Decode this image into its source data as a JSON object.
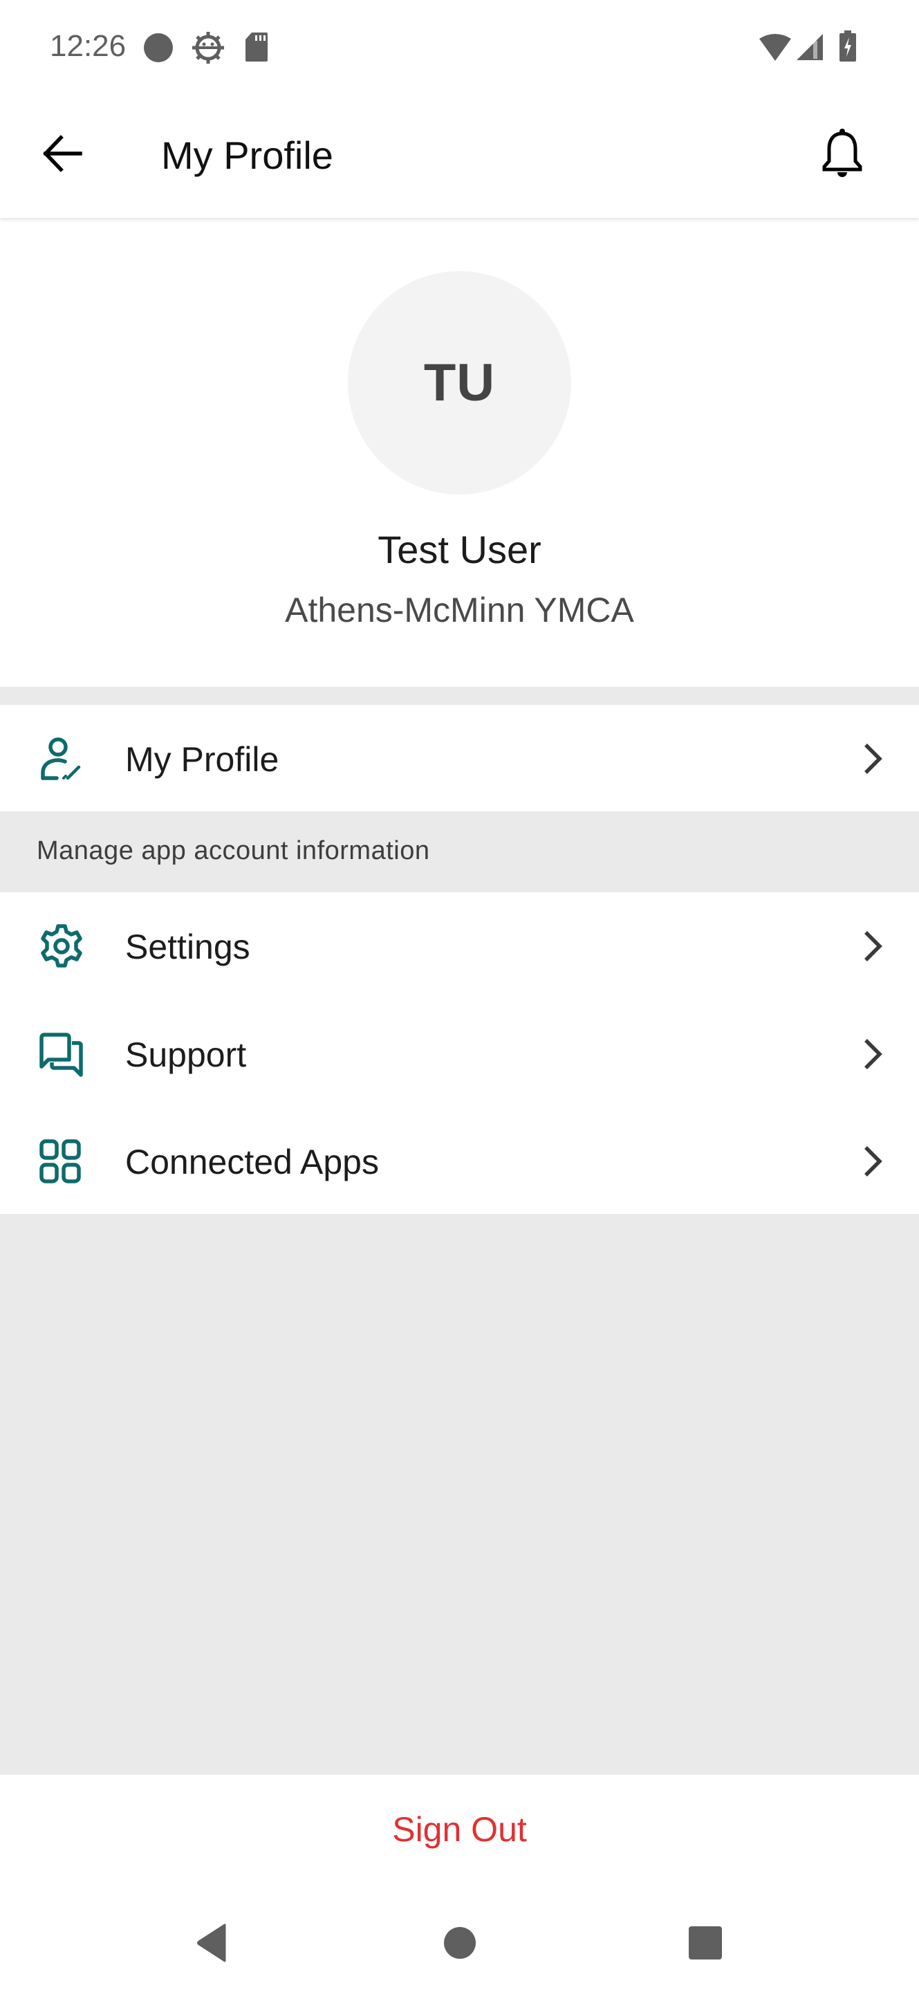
{
  "status_bar": {
    "time": "12:26",
    "left_icons": [
      "record-dot-icon",
      "android-debug-icon",
      "sd-card-icon"
    ],
    "right_icons": [
      "wifi-icon",
      "cell-signal-icon",
      "battery-charging-icon"
    ]
  },
  "app_bar": {
    "title": "My Profile",
    "back_icon": "arrow-left-icon",
    "notification_icon": "bell-icon"
  },
  "profile": {
    "initials": "TU",
    "name": "Test User",
    "organization": "Athens-McMinn YMCA"
  },
  "menu": {
    "primary": {
      "label": "My Profile",
      "icon": "user-edit-icon",
      "caption": "Manage app account information"
    },
    "items": [
      {
        "label": "Settings",
        "icon": "gear-icon"
      },
      {
        "label": "Support",
        "icon": "chat-bubbles-icon"
      },
      {
        "label": "Connected Apps",
        "icon": "grid-apps-icon"
      }
    ]
  },
  "sign_out": {
    "label": "Sign Out"
  },
  "colors": {
    "accent_teal": "#0e6b6b",
    "sign_out_red": "#e03131",
    "background_gray": "#eaeaea"
  },
  "nav_bar": {
    "buttons": [
      "back-triangle-icon",
      "home-circle-icon",
      "recents-square-icon"
    ]
  }
}
